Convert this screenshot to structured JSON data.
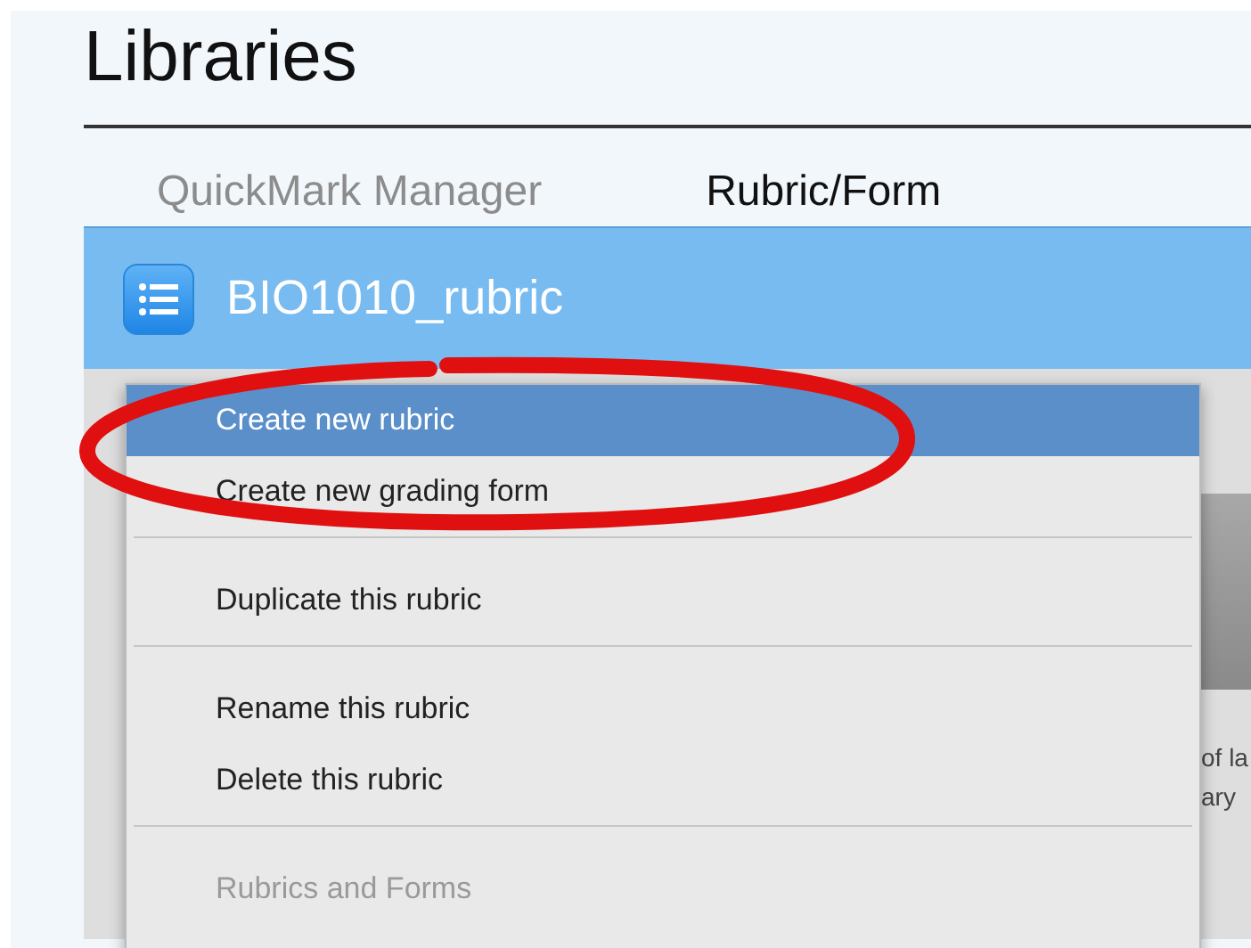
{
  "page": {
    "title": "Libraries"
  },
  "tabs": [
    {
      "label": "QuickMark Manager",
      "selected": false
    },
    {
      "label": "Rubric/Form",
      "selected": true
    }
  ],
  "header": {
    "title": "BIO1010_rubric"
  },
  "background_text": [
    "of la",
    "ary"
  ],
  "menu": [
    {
      "kind": "item",
      "label": "Create new rubric",
      "selected": true,
      "disabled": false
    },
    {
      "kind": "item",
      "label": "Create new grading form",
      "selected": false,
      "disabled": false
    },
    {
      "kind": "separator"
    },
    {
      "kind": "item",
      "label": "Duplicate this rubric",
      "selected": false,
      "disabled": false
    },
    {
      "kind": "separator"
    },
    {
      "kind": "item",
      "label": "Rename this rubric",
      "selected": false,
      "disabled": false
    },
    {
      "kind": "item",
      "label": "Delete this rubric",
      "selected": false,
      "disabled": false
    },
    {
      "kind": "separator"
    },
    {
      "kind": "item",
      "label": "Rubrics and Forms",
      "selected": false,
      "disabled": true
    }
  ]
}
